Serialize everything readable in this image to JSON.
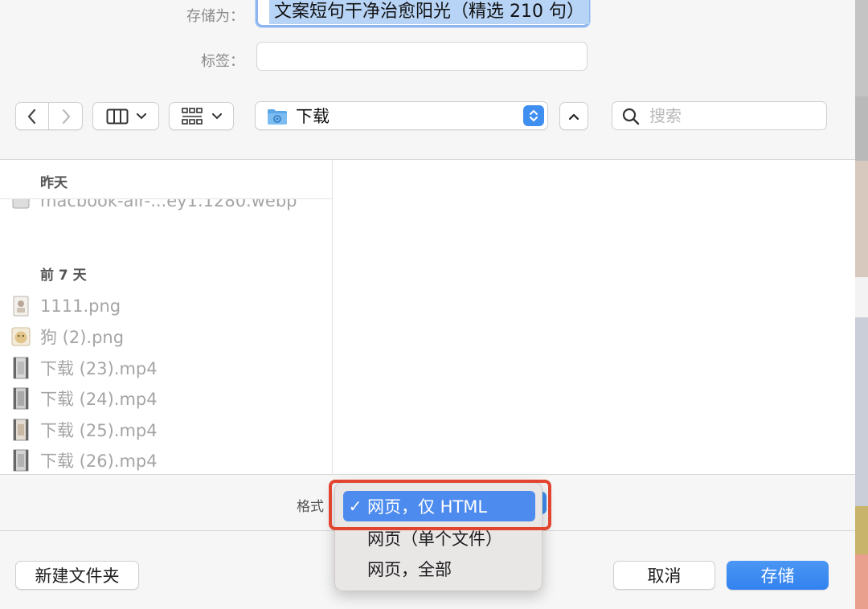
{
  "save_as": {
    "label": "存储为：",
    "value": "文案短句干净治愈阳光（精选 210 句）"
  },
  "tags": {
    "label": "标签：",
    "value": ""
  },
  "toolbar": {
    "back_icon": "chevron-left-icon",
    "forward_icon": "chevron-right-icon",
    "view_columns_icon": "columns-view-icon",
    "view_grid_icon": "grid-view-icon",
    "location": "下载",
    "expand_icon": "chevron-up-icon"
  },
  "search": {
    "placeholder": "搜索"
  },
  "file_list": {
    "groups": [
      {
        "title": "昨天",
        "items": [
          {
            "name": "macbook-air-...ey1.1280.webp"
          }
        ]
      },
      {
        "title": "前 7 天",
        "items": [
          {
            "name": "1111.png"
          },
          {
            "name": "狗 (2).png"
          },
          {
            "name": "下载 (23).mp4"
          },
          {
            "name": "下载 (24).mp4"
          },
          {
            "name": "下载 (25).mp4"
          },
          {
            "name": "下载 (26).mp4"
          }
        ]
      }
    ]
  },
  "format": {
    "label": "格式",
    "options": [
      {
        "label": "网页，仅 HTML",
        "selected": true
      },
      {
        "label": "网页（单个文件）",
        "selected": false
      },
      {
        "label": "网页，全部",
        "selected": false
      }
    ],
    "check_mark": "✓"
  },
  "buttons": {
    "new_folder": "新建文件夹",
    "cancel": "取消",
    "save": "存储"
  },
  "colors": {
    "accent": "#3f8ff0",
    "highlight_outline": "#e2452f",
    "selection": "#4d8bee"
  }
}
